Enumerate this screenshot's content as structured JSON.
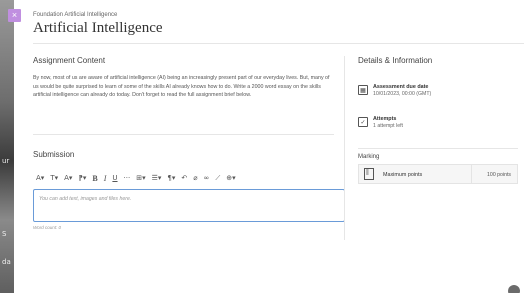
{
  "header": {
    "breadcrumb": "Foundation Artificial Intelligence",
    "title": "Artificial Intelligence",
    "close_icon": "×"
  },
  "assignment": {
    "section_title": "Assignment Content",
    "body": "By now, most of us are aware of artificial intelligence (AI) being an increasingly present part of our everyday lives. But, many of us would be quite surprised to learn of some of the skills AI already knows how to do. Write a 2000 word essay on the skills artificial intelligence can already do today. Don't forget to read the full assignment brief below."
  },
  "submission": {
    "section_title": "Submission",
    "toolbar": [
      "A▾",
      "T▾",
      "A▾",
      "⁋▾",
      "B",
      "I",
      "U",
      "···",
      "⊞▾",
      "☰▾",
      "¶▾",
      "↶",
      "⌀",
      "∞",
      "⟋",
      "⊕▾"
    ],
    "editor_placeholder": "You can add text, images and files here.",
    "word_count": "Word count: 0"
  },
  "details": {
    "title": "Details & Information",
    "due_label": "Assessment due date",
    "due_value": "10/01/2023, 00:00 (GMT)",
    "attempts_label": "Attempts",
    "attempts_value": "1 attempt left",
    "marking_title": "Marking",
    "points_label": "Maximum points",
    "points_value": "100 points"
  },
  "background": {
    "fragments": [
      "ur",
      "S",
      "da"
    ]
  },
  "colors": {
    "accent_close": "#c08fe0",
    "editor_border": "#6a9bd8"
  }
}
